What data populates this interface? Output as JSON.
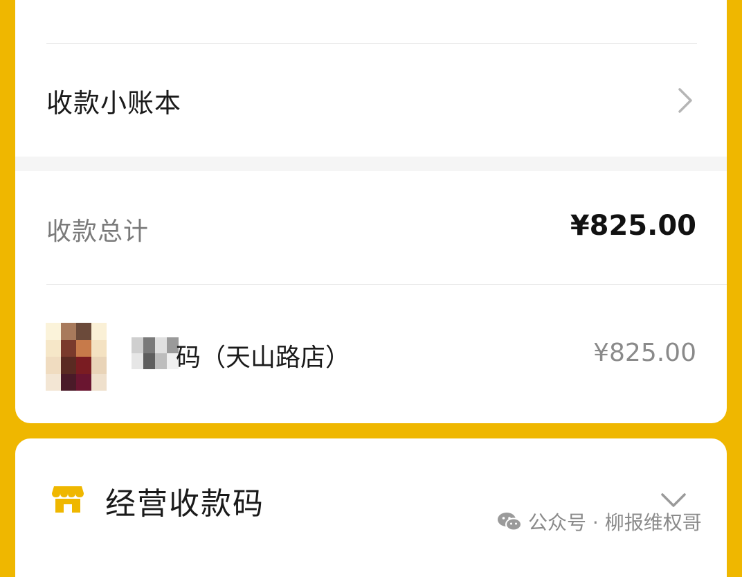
{
  "ledger": {
    "label": "收款小账本"
  },
  "summary": {
    "total_label": "收款总计",
    "total_value": "¥825.00"
  },
  "store": {
    "name": "码（天山路店）",
    "amount": "¥825.00"
  },
  "business_code": {
    "title": "经营收款码"
  },
  "watermark": {
    "text": "公众号 · 柳报维权哥"
  },
  "colors": {
    "brand_yellow": "#EFB700",
    "card": "#ffffff"
  }
}
